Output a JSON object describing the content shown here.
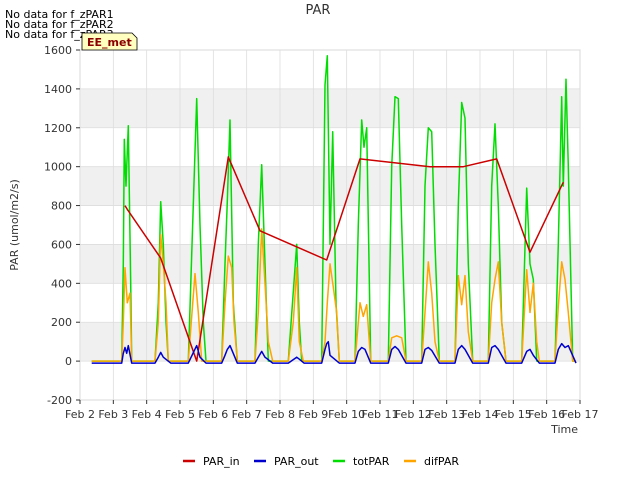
{
  "messages": [
    "No data for f_zPAR1",
    "No data for f_zPAR2",
    "No data for f_zPAR3"
  ],
  "site_label": "EE_met",
  "chart_data": {
    "type": "line",
    "title": "PAR",
    "xlabel": "Time",
    "ylabel": "PAR (umol/m2/s)",
    "xlim": [
      2,
      17
    ],
    "ylim": [
      -200,
      1600
    ],
    "x_ticks": [
      2,
      3,
      4,
      5,
      6,
      7,
      8,
      9,
      10,
      11,
      12,
      13,
      14,
      15,
      16,
      17
    ],
    "x_tick_labels": [
      "Feb 2",
      "Feb 3",
      "Feb 4",
      "Feb 5",
      "Feb 6",
      "Feb 7",
      "Feb 8",
      "Feb 9",
      "Feb 10",
      "Feb 11",
      "Feb 12",
      "Feb 13",
      "Feb 14",
      "Feb 15",
      "Feb 16",
      "Feb 17"
    ],
    "y_ticks": [
      -200,
      0,
      200,
      400,
      600,
      800,
      1000,
      1200,
      1400,
      1600
    ],
    "y_tick_labels": [
      "-200",
      "0",
      "200",
      "400",
      "600",
      "800",
      "1000",
      "1200",
      "1400",
      "1600"
    ],
    "grid": true,
    "legend_position": "bottom",
    "colors": {
      "PAR_in": "#cc0000",
      "PAR_out": "#0000cc",
      "totPAR": "#00dd00",
      "difPAR": "#ffa500"
    },
    "series": [
      {
        "name": "totPAR",
        "x": [
          2.35,
          3.25,
          3.3,
          3.33,
          3.38,
          3.45,
          3.52,
          3.55,
          4.25,
          4.35,
          4.42,
          4.5,
          4.58,
          4.65,
          4.72,
          5.25,
          5.5,
          5.6,
          5.7,
          5.78,
          6.25,
          6.35,
          6.42,
          6.5,
          6.6,
          6.72,
          7.25,
          7.35,
          7.45,
          7.55,
          7.65,
          7.78,
          8.25,
          8.5,
          8.58,
          8.65,
          8.72,
          9.25,
          9.35,
          9.42,
          9.5,
          9.58,
          9.68,
          9.78,
          10.25,
          10.35,
          10.45,
          10.52,
          10.6,
          10.72,
          11.25,
          11.35,
          11.45,
          11.55,
          11.65,
          11.78,
          12.25,
          12.35,
          12.45,
          12.55,
          12.65,
          12.78,
          13.25,
          13.35,
          13.45,
          13.55,
          13.65,
          13.78,
          14.25,
          14.35,
          14.45,
          14.55,
          14.65,
          14.78,
          15.25,
          15.4,
          15.5,
          15.6,
          15.7,
          15.78,
          16.25,
          16.35,
          16.45,
          16.5,
          16.58,
          16.65,
          16.78,
          16.88
        ],
        "y": [
          0,
          0,
          500,
          1140,
          900,
          1210,
          400,
          0,
          0,
          300,
          820,
          600,
          200,
          0,
          0,
          0,
          1350,
          700,
          200,
          0,
          0,
          500,
          820,
          1240,
          300,
          0,
          0,
          600,
          1010,
          500,
          0,
          0,
          0,
          600,
          200,
          0,
          0,
          0,
          1420,
          1570,
          600,
          1180,
          300,
          0,
          0,
          700,
          1240,
          1100,
          1200,
          0,
          0,
          1000,
          1360,
          1350,
          700,
          0,
          0,
          900,
          1200,
          1180,
          600,
          0,
          0,
          800,
          1330,
          1250,
          500,
          0,
          0,
          900,
          1220,
          800,
          200,
          0,
          0,
          890,
          500,
          420,
          0,
          0,
          0,
          600,
          1360,
          900,
          1450,
          1000,
          0,
          0
        ]
      },
      {
        "name": "difPAR",
        "x": [
          2.35,
          3.25,
          3.3,
          3.35,
          3.42,
          3.5,
          3.55,
          4.25,
          4.35,
          4.42,
          4.5,
          4.58,
          4.65,
          4.72,
          5.25,
          5.45,
          5.55,
          5.65,
          5.78,
          6.25,
          6.35,
          6.45,
          6.55,
          6.62,
          6.72,
          7.25,
          7.35,
          7.45,
          7.55,
          7.65,
          7.78,
          8.25,
          8.4,
          8.5,
          8.58,
          8.7,
          9.25,
          9.35,
          9.42,
          9.5,
          9.6,
          9.7,
          9.78,
          10.25,
          10.4,
          10.5,
          10.6,
          10.72,
          11.25,
          11.35,
          11.5,
          11.65,
          11.78,
          12.25,
          12.35,
          12.45,
          12.55,
          12.65,
          12.78,
          13.25,
          13.35,
          13.45,
          13.55,
          13.65,
          13.78,
          14.25,
          14.35,
          14.45,
          14.55,
          14.65,
          14.78,
          15.25,
          15.4,
          15.5,
          15.6,
          15.7,
          15.78,
          16.25,
          16.35,
          16.45,
          16.55,
          16.65,
          16.78,
          16.88
        ],
        "y": [
          0,
          0,
          200,
          480,
          300,
          350,
          0,
          0,
          200,
          650,
          500,
          300,
          0,
          0,
          0,
          450,
          250,
          0,
          0,
          0,
          300,
          540,
          480,
          200,
          0,
          0,
          250,
          680,
          400,
          100,
          0,
          0,
          200,
          480,
          100,
          0,
          0,
          100,
          300,
          500,
          380,
          250,
          0,
          0,
          300,
          230,
          290,
          0,
          0,
          120,
          130,
          120,
          0,
          0,
          250,
          510,
          350,
          100,
          0,
          0,
          440,
          290,
          440,
          150,
          0,
          0,
          300,
          420,
          510,
          200,
          0,
          0,
          470,
          250,
          400,
          100,
          0,
          0,
          280,
          510,
          420,
          250,
          0,
          0
        ]
      },
      {
        "name": "PAR_in",
        "x": [
          3.35,
          3.42,
          4.42,
          5.5,
          6.45,
          7.4,
          9.4,
          10.4,
          12.5,
          13.5,
          14.5,
          15.5,
          16.5
        ],
        "y": [
          800,
          780,
          530,
          0,
          1050,
          670,
          520,
          1040,
          1000,
          1000,
          1040,
          560,
          920
        ]
      },
      {
        "name": "PAR_out",
        "x": [
          2.35,
          3.25,
          3.3,
          3.35,
          3.4,
          3.45,
          3.55,
          4.25,
          4.35,
          4.42,
          4.5,
          4.72,
          5.25,
          5.5,
          5.6,
          5.78,
          6.25,
          6.35,
          6.42,
          6.5,
          6.72,
          7.25,
          7.35,
          7.45,
          7.55,
          7.78,
          8.25,
          8.5,
          8.58,
          8.72,
          9.25,
          9.35,
          9.4,
          9.45,
          9.5,
          9.78,
          10.25,
          10.35,
          10.45,
          10.55,
          10.72,
          11.25,
          11.35,
          11.45,
          11.55,
          11.78,
          12.25,
          12.35,
          12.45,
          12.55,
          12.78,
          13.25,
          13.35,
          13.45,
          13.55,
          13.78,
          14.25,
          14.35,
          14.45,
          14.55,
          14.78,
          15.25,
          15.4,
          15.5,
          15.6,
          15.78,
          16.25,
          16.35,
          16.45,
          16.55,
          16.65,
          16.88
        ],
        "y": [
          -10,
          -10,
          40,
          70,
          40,
          80,
          -10,
          -10,
          20,
          45,
          20,
          -10,
          -10,
          80,
          20,
          -10,
          -10,
          30,
          60,
          80,
          -10,
          -10,
          20,
          50,
          20,
          -10,
          -10,
          20,
          10,
          -10,
          -10,
          60,
          90,
          100,
          30,
          -10,
          -10,
          50,
          70,
          60,
          -10,
          -10,
          60,
          75,
          60,
          -10,
          -10,
          60,
          70,
          55,
          -10,
          -10,
          60,
          80,
          60,
          -10,
          -10,
          70,
          80,
          60,
          -10,
          -10,
          50,
          60,
          30,
          -10,
          -10,
          60,
          90,
          70,
          80,
          -10
        ]
      }
    ]
  }
}
